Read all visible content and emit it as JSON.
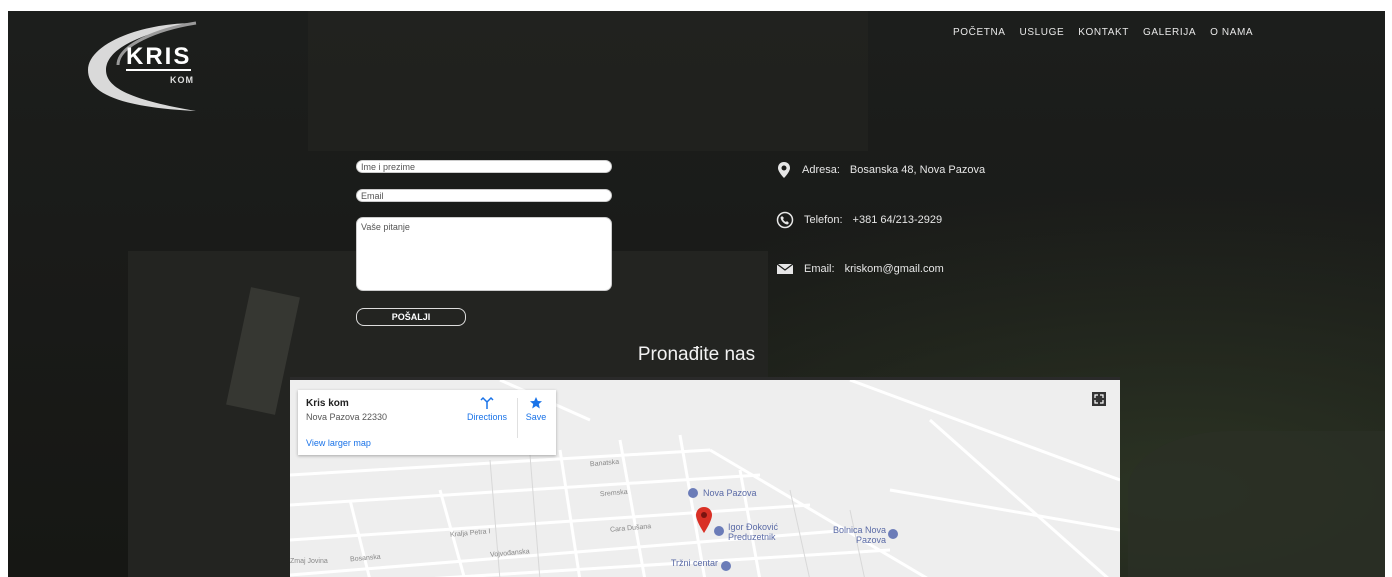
{
  "logo": {
    "main": "KRIS",
    "sub": "KOM"
  },
  "nav": [
    "POČETNA",
    "USLUGE",
    "KONTAKT",
    "GALERIJA",
    "O NAMA"
  ],
  "form": {
    "name_placeholder": "Ime i prezime",
    "email_placeholder": "Email",
    "message_placeholder": "Vaše pitanje",
    "submit_label": "POŠALJI"
  },
  "contact": {
    "address_label": "Adresa:",
    "address_value": "Bosanska 48, Nova Pazova",
    "phone_label": "Telefon:",
    "phone_value": "+381 64/213-2929",
    "email_label": "Email:",
    "email_value": "kriskom@gmail.com"
  },
  "map_section": {
    "title": "Pronađite nas",
    "card": {
      "place_name": "Kris kom",
      "address": "Nova Pazova 22330",
      "directions_label": "Directions",
      "save_label": "Save",
      "larger_map_label": "View larger map"
    },
    "pois": [
      "Nova Pazova",
      "Igor Đoković Preduzetnik",
      "Bolnica Nova Pazova",
      "Tržni centar"
    ],
    "streets": [
      "Banatska",
      "Sremska",
      "Kralja Petra I",
      "Cara Dušana",
      "Bosanska",
      "Vojvođanska",
      "Zmaj Jovina"
    ]
  },
  "colors": {
    "pin": "#d93025",
    "poi": "#5a6aa6",
    "link": "#1a73e8"
  }
}
